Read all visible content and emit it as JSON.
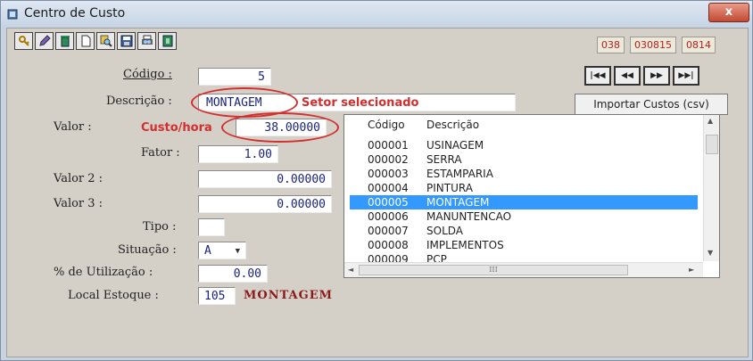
{
  "window": {
    "title": "Centro de Custo",
    "close_label": "x"
  },
  "toolbar": {
    "buttons": [
      "key-icon",
      "edit-icon",
      "delete-icon",
      "new-document-icon",
      "search-icon",
      "save-icon",
      "print-preview-icon",
      "exit-icon"
    ]
  },
  "header_codes": [
    "038",
    "030815",
    "0814"
  ],
  "nav": {
    "first": "|◀◀",
    "prev": "◀◀",
    "next": "▶▶",
    "last": "▶▶|"
  },
  "import_button": "Importar Custos (csv)",
  "form": {
    "codigo_label": "Código :",
    "codigo_value": "5",
    "descricao_label": "Descrição :",
    "descricao_value": "MONTAGEM",
    "valor_label": "Valor :",
    "valor_value": "38.00000",
    "fator_label": "Fator :",
    "fator_value": "1.00",
    "valor2_label": "Valor 2 :",
    "valor2_value": "0.00000",
    "valor3_label": "Valor 3 :",
    "valor3_value": "0.00000",
    "tipo_label": "Tipo :",
    "tipo_value": "",
    "situacao_label": "Situação :",
    "situacao_value": "A",
    "utilizacao_label": "% de Utilização :",
    "utilizacao_value": "0.00",
    "local_label": "Local Estoque :",
    "local_code": "105",
    "local_desc": "MONTAGEM"
  },
  "annotations": {
    "setor": "Setor selecionado",
    "custo": "Custo/hora"
  },
  "list": {
    "col_code": "Código",
    "col_desc": "Descrição",
    "rows": [
      {
        "code": "000001",
        "desc": "USINAGEM"
      },
      {
        "code": "000002",
        "desc": "SERRA"
      },
      {
        "code": "000003",
        "desc": "ESTAMPARIA"
      },
      {
        "code": "000004",
        "desc": "PINTURA"
      },
      {
        "code": "000005",
        "desc": "MONTAGEM"
      },
      {
        "code": "000006",
        "desc": "MANUNTENCAO"
      },
      {
        "code": "000007",
        "desc": "SOLDA"
      },
      {
        "code": "000008",
        "desc": "IMPLEMENTOS"
      },
      {
        "code": "000009",
        "desc": "PCP"
      }
    ],
    "selected_index": 4,
    "hscroll_text": "III"
  }
}
